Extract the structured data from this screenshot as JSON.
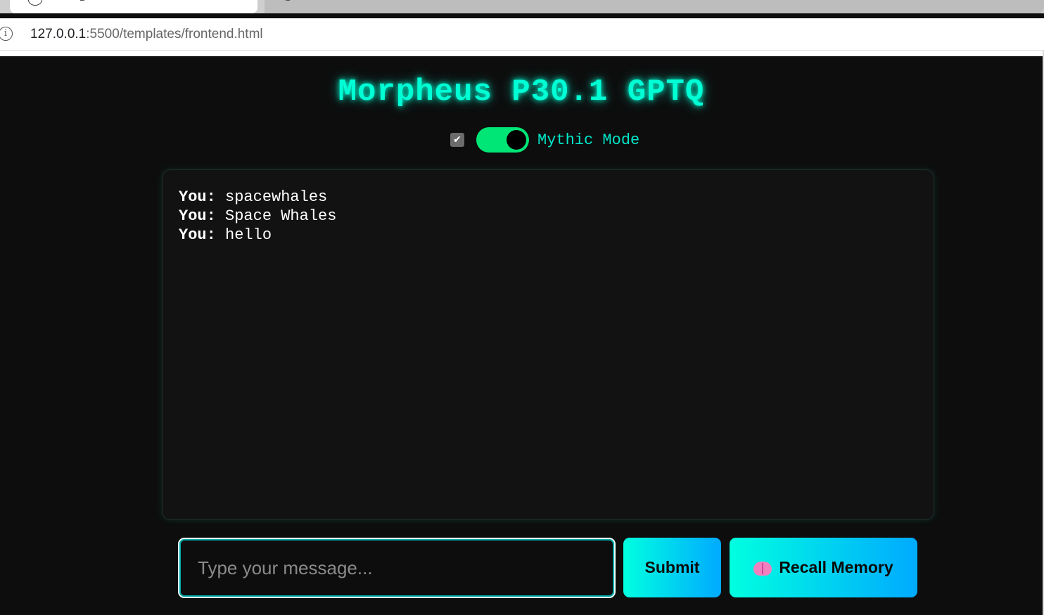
{
  "browser": {
    "url_host": "127.0.0.1",
    "url_path": ":5500/templates/frontend.html",
    "info_icon": "info-icon",
    "tab_icon": "globe-icon"
  },
  "app": {
    "title": "Morpheus P30.1 GPTQ",
    "mode_label": "Mythic Mode",
    "mode_checked": true,
    "mode_toggle_on": true,
    "accent_color": "#00ffd5"
  },
  "chat": {
    "messages": [
      {
        "speaker": "You:",
        "text": "spacewhales"
      },
      {
        "speaker": "You:",
        "text": "Space Whales"
      },
      {
        "speaker": "You:",
        "text": "hello"
      }
    ]
  },
  "composer": {
    "placeholder": "Type your message...",
    "value": "",
    "submit_label": "Submit",
    "recall_label": "Recall Memory",
    "recall_icon": "brain-icon"
  }
}
